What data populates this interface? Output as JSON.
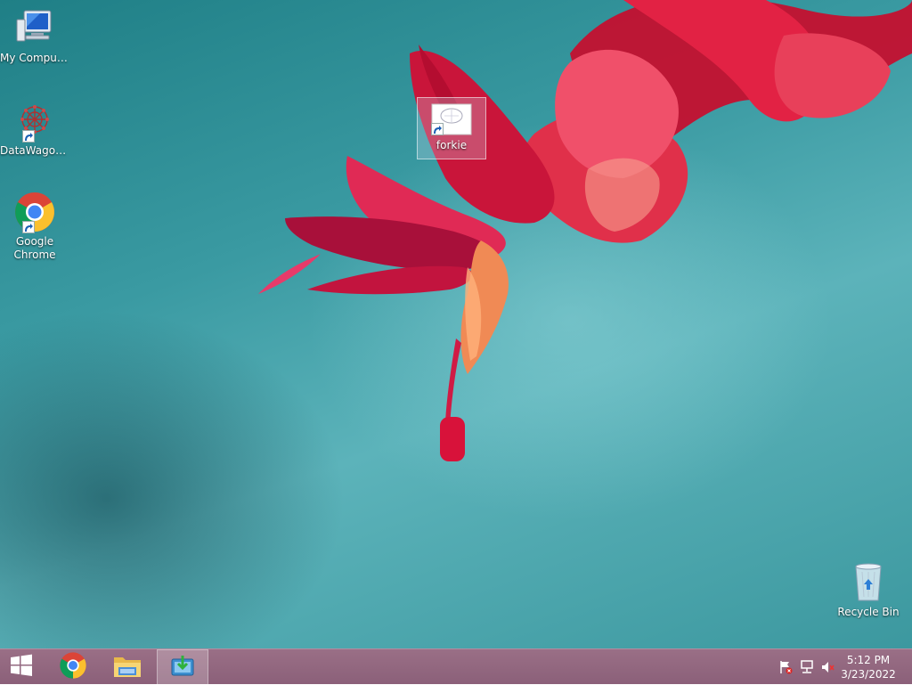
{
  "desktop": {
    "icons": [
      {
        "label": "My Computer",
        "icon": "computer-icon",
        "shortcut": false
      },
      {
        "label": "DataWagon...",
        "icon": "datawagon-icon",
        "shortcut": true
      },
      {
        "label": "Google Chrome",
        "icon": "chrome-icon",
        "shortcut": true
      },
      {
        "label": "forkie",
        "icon": "document-icon",
        "shortcut": true,
        "selected": true
      },
      {
        "label": "Recycle Bin",
        "icon": "recycle-bin-icon",
        "shortcut": false
      }
    ]
  },
  "taskbar": {
    "buttons": [
      {
        "name": "start",
        "icon": "windows-logo-icon"
      },
      {
        "name": "chrome",
        "icon": "chrome-icon"
      },
      {
        "name": "file-explorer",
        "icon": "folder-icon"
      },
      {
        "name": "installer",
        "icon": "install-icon",
        "active": true
      }
    ],
    "tray": {
      "icons": [
        "action-center-flag-icon",
        "network-icon",
        "volume-muted-icon"
      ],
      "time": "5:12 PM",
      "date": "3/23/2022"
    }
  },
  "colors": {
    "taskbar": "#8b6079",
    "desktop_teal": "#3a9aa2",
    "flower_red": "#d8123a"
  }
}
